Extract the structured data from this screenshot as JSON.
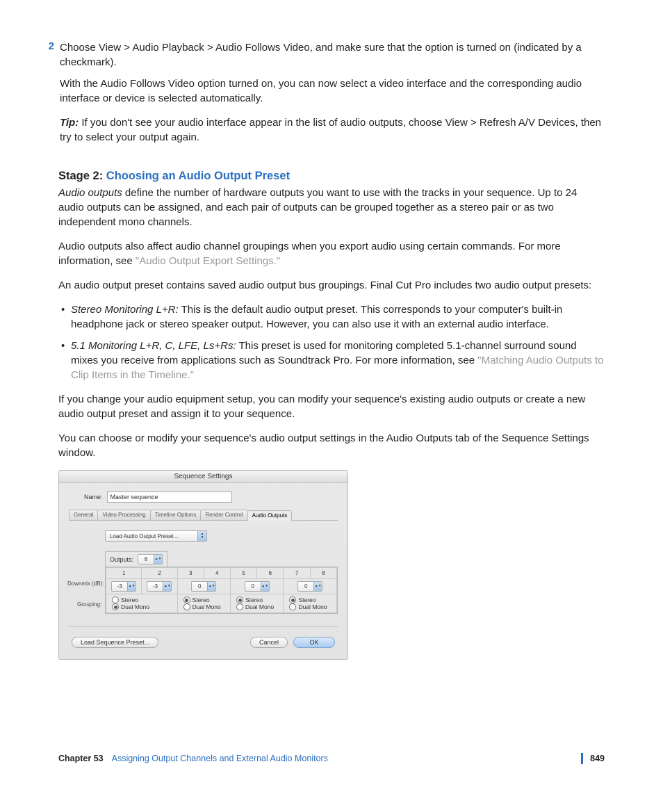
{
  "step": {
    "number": "2",
    "text": "Choose View > Audio Playback > Audio Follows Video, and make sure that the option is turned on (indicated by a checkmark).",
    "sub1": "With the Audio Follows Video option turned on, you can now select a video interface and the corresponding audio interface or device is selected automatically.",
    "tip_label": "Tip:",
    "tip_text": "  If you don't see your audio interface appear in the list of audio outputs, choose View > Refresh A/V Devices, then try to select your output again."
  },
  "heading": {
    "black": "Stage 2: ",
    "blue": "Choosing an Audio Output Preset"
  },
  "para1a": "Audio outputs",
  "para1b": " define the number of hardware outputs you want to use with the tracks in your sequence. Up to 24 audio outputs can be assigned, and each pair of outputs can be grouped together as a stereo pair or as two independent mono channels.",
  "para2a": "Audio outputs also affect audio channel groupings when you export audio using certain commands. For more information, see ",
  "para2link": "\"Audio Output Export Settings.\"",
  "para3": "An audio output preset contains saved audio output bus groupings. Final Cut Pro includes two audio output presets:",
  "bullets": [
    {
      "em": "Stereo Monitoring L+R:",
      "text": "  This is the default audio output preset. This corresponds to your computer's built-in headphone jack or stereo speaker output. However, you can also use it with an external audio interface."
    },
    {
      "em": "5.1 Monitoring L+R, C, LFE, Ls+Rs:",
      "text": "  This preset is used for monitoring completed 5.1-channel surround sound mixes you receive from applications such as Soundtrack Pro. For more information, see ",
      "link": "\"Matching Audio Outputs to Clip Items in the Timeline.\""
    }
  ],
  "para4": "If you change your audio equipment setup, you can modify your sequence's existing audio outputs or create a new audio output preset and assign it to your sequence.",
  "para5": "You can choose or modify your sequence's audio output settings in the Audio Outputs tab of the Sequence Settings window.",
  "screenshot": {
    "title": "Sequence Settings",
    "name_label": "Name:",
    "name_value": "Master sequence",
    "tabs": [
      "General",
      "Video Processing",
      "Timeline Options",
      "Render Control",
      "Audio Outputs"
    ],
    "preset_label": "Load Audio Output Preset...",
    "outputs_label": "Outputs:",
    "outputs_value": "8",
    "col_headers": [
      "1",
      "2",
      "3",
      "4",
      "5",
      "6",
      "7",
      "8"
    ],
    "downmix_label": "Downmix (dB):",
    "downmix_values": [
      "-3",
      "-3",
      "0",
      "0",
      "0"
    ],
    "grouping_label": "Grouping:",
    "radio_stereo": "Stereo",
    "radio_dual": "Dual Mono",
    "load_seq_btn": "Load Sequence Preset...",
    "cancel_btn": "Cancel",
    "ok_btn": "OK"
  },
  "footer": {
    "chapter": "Chapter 53",
    "title": "Assigning Output Channels and External Audio Monitors",
    "page": "849"
  }
}
